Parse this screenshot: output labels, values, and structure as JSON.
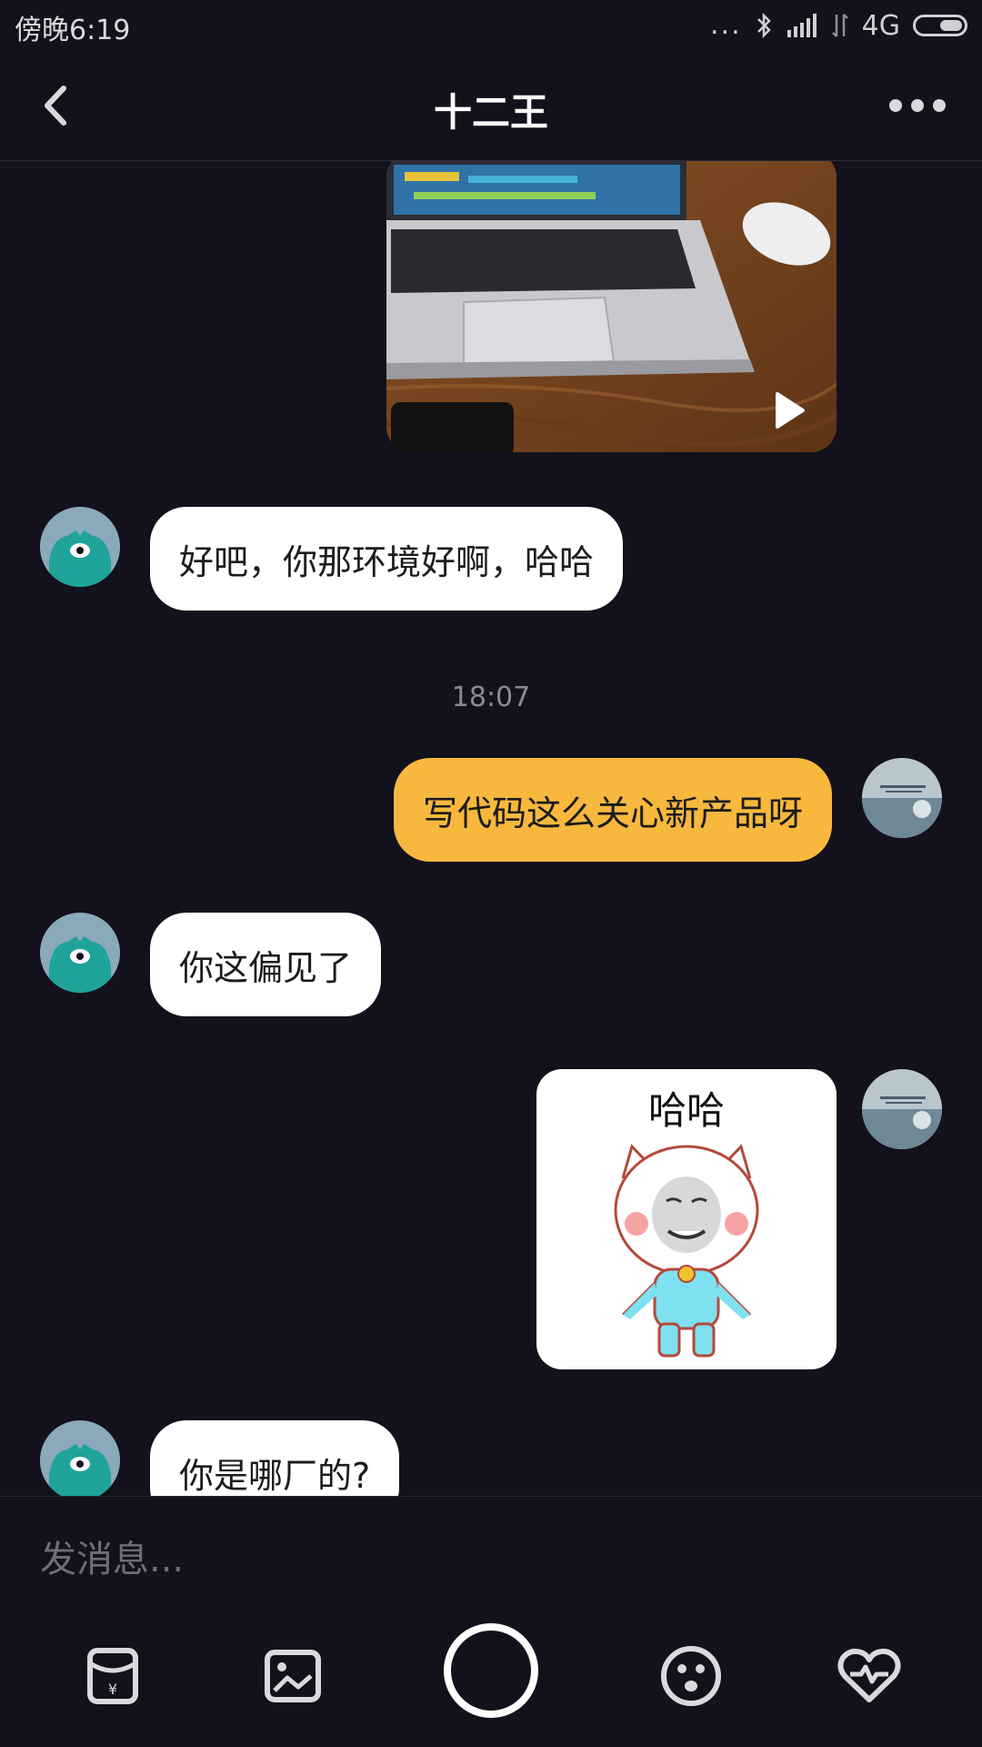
{
  "status_bar": {
    "time": "傍晚6:19",
    "dots": "...",
    "network": "4G",
    "icons": [
      "bluetooth-icon",
      "signal-icon",
      "data-icon",
      "battery-icon"
    ]
  },
  "header": {
    "title": "十二王",
    "back_icon": "chevron-left-icon",
    "more_icon": "more-dots-icon"
  },
  "messages": [
    {
      "sender": "me",
      "type": "video",
      "icon": "play-icon"
    },
    {
      "sender": "other",
      "type": "text",
      "text": "好吧，你那环境好啊，哈哈"
    },
    {
      "type": "timestamp",
      "text": "18:07"
    },
    {
      "sender": "me",
      "type": "text",
      "text": "写代码这么关心新产品呀"
    },
    {
      "sender": "other",
      "type": "text",
      "text": "你这偏见了"
    },
    {
      "sender": "me",
      "type": "sticker",
      "text": "哈哈"
    },
    {
      "sender": "other",
      "type": "text",
      "text": "你是哪厂的?"
    }
  ],
  "input": {
    "placeholder": "发消息..."
  },
  "toolbar": {
    "items": [
      "red-packet-icon",
      "image-icon",
      "record-button",
      "emoji-icon",
      "heart-icon"
    ]
  },
  "colors": {
    "background": "#12111c",
    "my_bubble": "#f7b83d",
    "other_bubble": "#ffffff",
    "avatar_teal": "#1fa39a"
  }
}
